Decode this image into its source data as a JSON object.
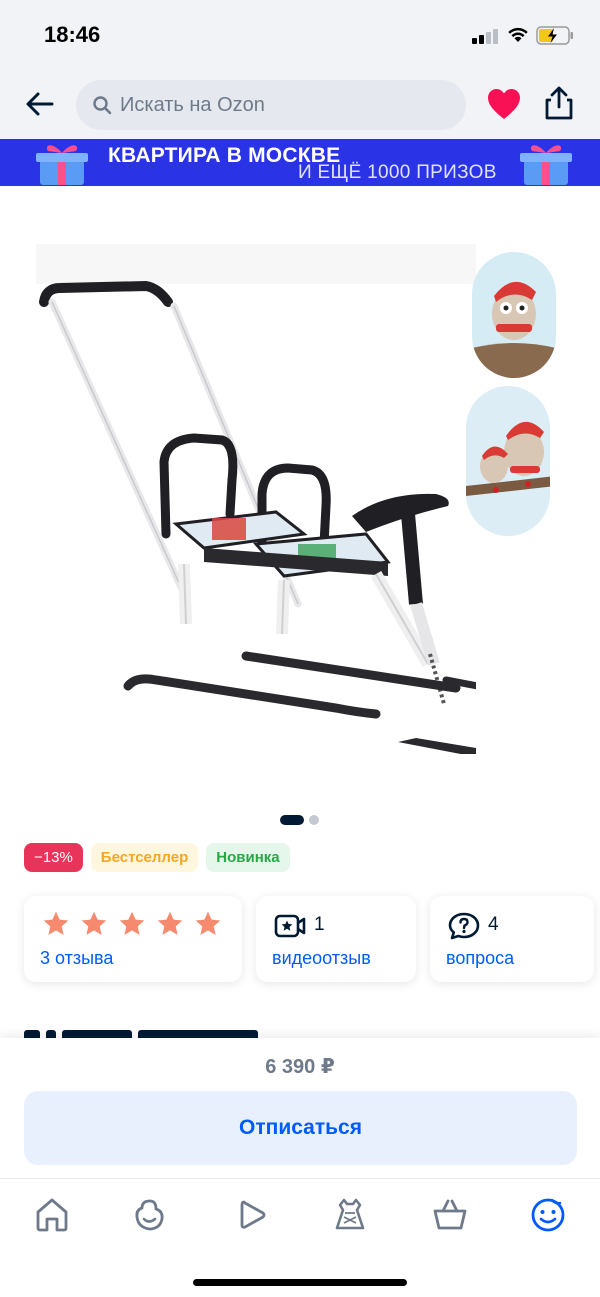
{
  "status_bar": {
    "time": "18:46"
  },
  "header": {
    "search_placeholder": "Искать на Ozon",
    "icons": [
      "back-arrow-icon",
      "search-icon",
      "heart-icon",
      "share-icon"
    ],
    "favorite_color": "#f91155"
  },
  "banner": {
    "title": "КВАРТИРА В МОСКВЕ",
    "subtitle": "И ЕЩЁ 1000 ПРИЗОВ",
    "background": "#2b33e6"
  },
  "gallery": {
    "image_count": 2,
    "active_index": 1
  },
  "badges": [
    {
      "label": "−13%",
      "type": "discount"
    },
    {
      "label": "Бестселлер",
      "type": "bestseller"
    },
    {
      "label": "Новинка",
      "type": "new"
    }
  ],
  "cards": {
    "rating": {
      "stars": 5,
      "reviews_label": "3 отзыва",
      "star_color": "#f58a6e"
    },
    "video": {
      "count": "1",
      "label": "видеоотзыв",
      "icon": "video-star-icon"
    },
    "questions": {
      "count": "4",
      "label": "вопроса",
      "icon": "question-bubble-icon"
    }
  },
  "bottom_sheet": {
    "price": "6 390 ₽",
    "unsubscribe_label": "Отписаться"
  },
  "tabbar": {
    "tabs": [
      "home-icon",
      "fresh-icon",
      "video-play-icon",
      "fashion-icon",
      "cart-icon",
      "profile-icon"
    ],
    "active_tab": "profile-icon",
    "active_color": "#005bff"
  }
}
